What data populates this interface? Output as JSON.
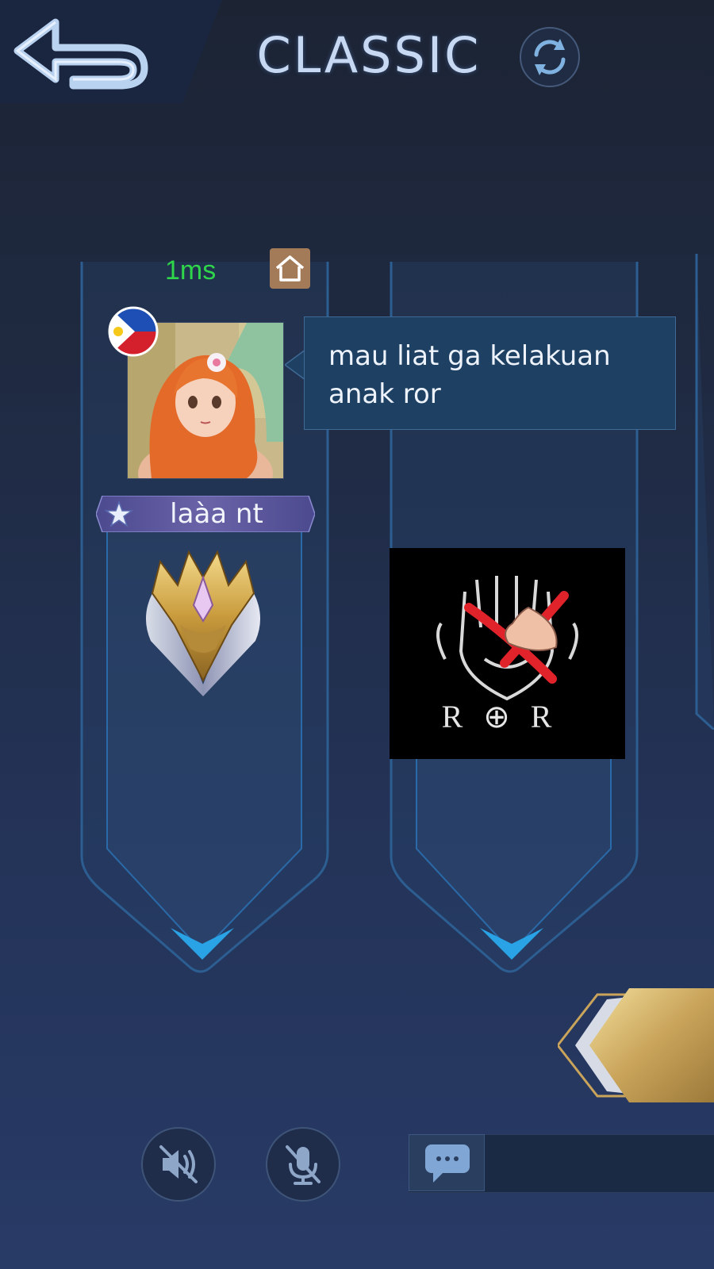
{
  "header": {
    "back_icon": "back-arrow-icon",
    "title": "CLASSIC",
    "refresh_icon": "refresh-icon"
  },
  "player": {
    "ping": "1ms",
    "home_icon": "home-icon",
    "flag_icon": "philippines-flag-icon",
    "avatar": "anime-avatar",
    "name": "laàa nt",
    "rank_icon": "mythic-rank-emblem-icon",
    "chat_message": "mau liat ga kelakuan anak ror"
  },
  "slot2": {
    "image": "ror-logo",
    "logo_text": "R⊕R"
  },
  "controls": {
    "ready_button": "ready-button",
    "speaker_icon": "speaker-muted-icon",
    "mic_icon": "mic-muted-icon",
    "chat_icon": "chat-bubble-icon"
  },
  "colors": {
    "ping": "#2fd54a",
    "title": "#c6d8f2",
    "home_bg": "#a47b58",
    "bubble_bg": "#1d4063",
    "slot_border": "#3d8fd6"
  }
}
